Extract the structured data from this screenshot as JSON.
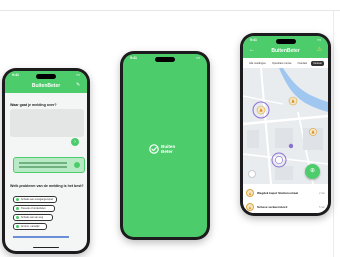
{
  "phones": {
    "feedback": {
      "status_time": "9:41",
      "title": "BuitenBeter",
      "question": "Waar gaat je melding over?",
      "question2": "Welk probleem van de melding is het best?",
      "options": [
        "Schade aan voetgangerspad",
        "Tweede of onderdelen",
        "Schade aan de weg",
        "Anders, namelijk"
      ]
    },
    "splash": {
      "status_time": "9:41",
      "brand_line1": "Buiten",
      "brand_line2": "Beter"
    },
    "map": {
      "status_time": "9:41",
      "title": "BuitenBeter",
      "chips": [
        "Alle meldingen",
        "Openbare ruimte",
        "Overlast",
        "Verkeer"
      ],
      "list": [
        {
          "text": "Wegdek kapot Stationsstraat",
          "meta": "2 min"
        },
        {
          "text": "Scheve verkeersbord",
          "meta": "5 min"
        }
      ]
    }
  },
  "colors": {
    "brand_green": "#4dcc6b",
    "warning_orange": "#e08a1e",
    "marker_purple": "#8b6fd6",
    "water_blue": "#9fc7f0"
  }
}
